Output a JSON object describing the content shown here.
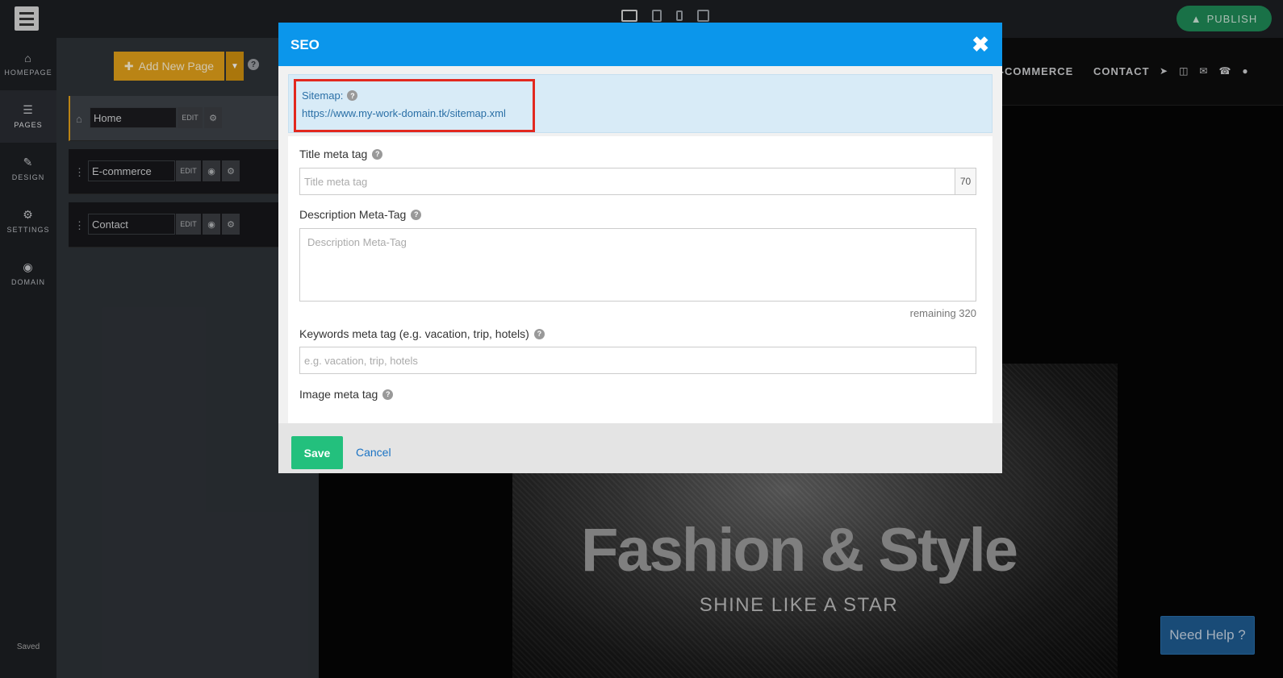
{
  "topbar": {
    "publish_label": "PUBLISH",
    "device_icons": [
      "desktop-icon",
      "tablet-icon",
      "mobile-icon",
      "external-link-icon"
    ]
  },
  "leftnav": {
    "items": [
      {
        "label": "HOMEPAGE",
        "icon": "home-icon"
      },
      {
        "label": "PAGES",
        "icon": "pages-icon"
      },
      {
        "label": "DESIGN",
        "icon": "brush-icon"
      },
      {
        "label": "SETTINGS",
        "icon": "gear-icon"
      },
      {
        "label": "DOMAIN",
        "icon": "globe-icon"
      }
    ],
    "active": "PAGES",
    "status": "Saved"
  },
  "pages_panel": {
    "add_label": "Add New Page",
    "pages": [
      {
        "name": "Home",
        "edit": "EDIT"
      },
      {
        "name": "E-commerce",
        "edit": "EDIT"
      },
      {
        "name": "Contact",
        "edit": "EDIT"
      }
    ]
  },
  "preview": {
    "nav_links": [
      "E-COMMERCE",
      "CONTACT"
    ],
    "hero_title": "Fashion & Style",
    "hero_subtitle": "SHINE LIKE A STAR",
    "help_label": "Need Help ?"
  },
  "modal": {
    "title": "SEO",
    "sitemap_label": "Sitemap:",
    "sitemap_url": "https://www.my-work-domain.tk/sitemap.xml",
    "title_tag_label": "Title meta tag",
    "title_tag_placeholder": "Title meta tag",
    "title_tag_counter": "70",
    "description_label": "Description Meta-Tag",
    "description_placeholder": "Description Meta-Tag",
    "remaining_text": "remaining  320",
    "keywords_label": "Keywords meta tag (e.g. vacation, trip, hotels)",
    "keywords_placeholder": "e.g. vacation, trip, hotels",
    "image_label": "Image meta tag",
    "save_label": "Save",
    "cancel_label": "Cancel"
  },
  "colors": {
    "modal_header": "#0b96eb",
    "save_button": "#23c07d",
    "publish_button": "#1f8a57",
    "add_page_button": "#e3a21a",
    "highlight_border": "#e2281f"
  }
}
